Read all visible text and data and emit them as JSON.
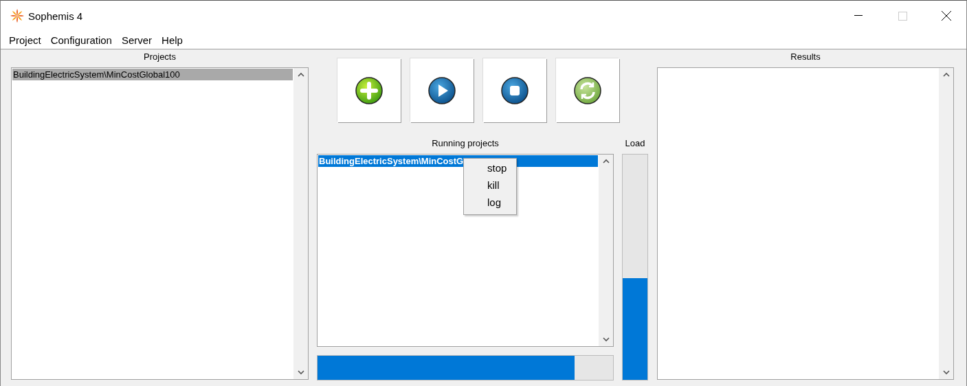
{
  "window": {
    "title": "Sophemis 4"
  },
  "menu": [
    "Project",
    "Configuration",
    "Server",
    "Help"
  ],
  "projects": {
    "title": "Projects",
    "items": [
      {
        "label": "BuildingElectricSystem\\MinCostGlobal100",
        "selected": true
      }
    ]
  },
  "toolbar": [
    {
      "kind": "add"
    },
    {
      "kind": "play"
    },
    {
      "kind": "stop"
    },
    {
      "kind": "refresh"
    }
  ],
  "running": {
    "title": "Running projects",
    "items": [
      {
        "label": "BuildingElectricSystem\\MinCostG",
        "selected": true
      }
    ],
    "progress": {
      "level": 0.87
    }
  },
  "context_menu": [
    "stop",
    "kill",
    "log"
  ],
  "load": {
    "title": "Load",
    "level": 0.45
  },
  "results": {
    "title": "Results"
  }
}
